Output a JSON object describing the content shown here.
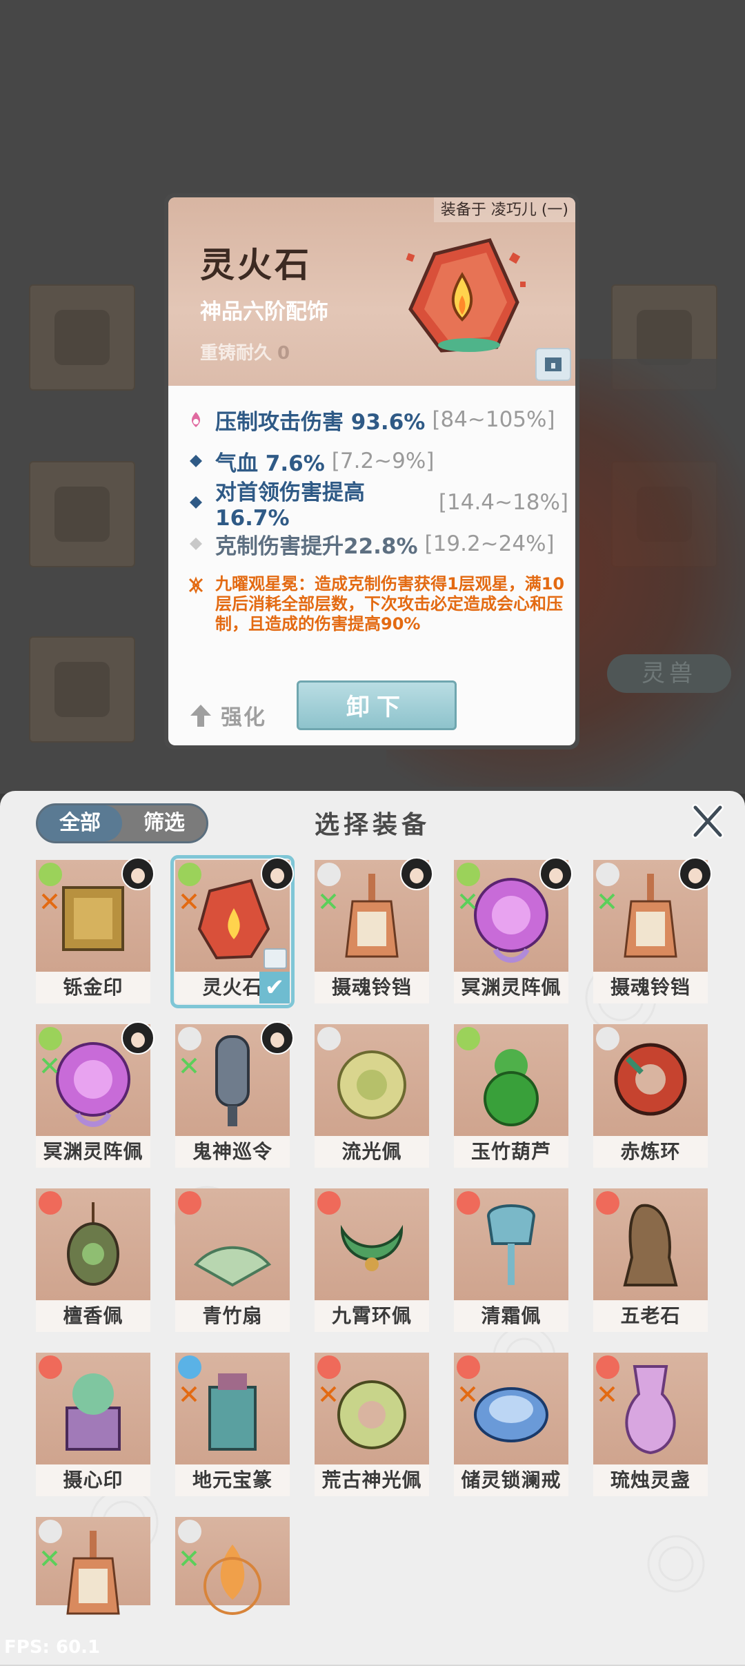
{
  "background": {
    "pet_button_label": "灵兽"
  },
  "detail": {
    "equipped_by": "装备于 凌巧儿 (一)",
    "name": "灵火石",
    "grade": "神品六阶配饰",
    "reforge_label": "重铸耐久",
    "reforge_value": "0",
    "stats": [
      {
        "name": "压制攻击伤害 93.6%",
        "range": "[84~105%]",
        "icon": "flame-icon"
      },
      {
        "name": "气血 7.6%",
        "range": "[7.2~9%]",
        "icon": "diamond-icon"
      },
      {
        "name": "对首领伤害提高 16.7%",
        "range": "[14.4~18%]",
        "icon": "diamond-icon"
      },
      {
        "name": "克制伤害提升22.8%",
        "range": "[19.2~24%]",
        "icon": "diamond-grey-icon"
      }
    ],
    "effect_text": "九曜观星冕：造成克制伤害获得1层观星，满10层后消耗全部层数，下次攻击必定造成会心和压制，且造成的伤害提高90%",
    "strengthen_label": "强化",
    "unequip_label": "卸下"
  },
  "panel": {
    "tabs": [
      "全部",
      "筛选"
    ],
    "title": "选择装备",
    "items": [
      {
        "name": "铄金印",
        "art": "seal"
      },
      {
        "name": "灵火石",
        "art": "stone",
        "selected": true
      },
      {
        "name": "摄魂铃铛",
        "art": "bell"
      },
      {
        "name": "冥渊灵阵佩",
        "art": "orb"
      },
      {
        "name": "摄魂铃铛",
        "art": "bell"
      },
      {
        "name": "冥渊灵阵佩",
        "art": "orb"
      },
      {
        "name": "鬼神巡令",
        "art": "token"
      },
      {
        "name": "流光佩",
        "art": "disc"
      },
      {
        "name": "玉竹葫芦",
        "art": "gourd"
      },
      {
        "name": "赤炼环",
        "art": "ring"
      },
      {
        "name": "檀香佩",
        "art": "pendant"
      },
      {
        "name": "青竹扇",
        "art": "fan"
      },
      {
        "name": "九霄环佩",
        "art": "crescent"
      },
      {
        "name": "清霜佩",
        "art": "frost"
      },
      {
        "name": "五老石",
        "art": "rock"
      },
      {
        "name": "摄心印",
        "art": "box"
      },
      {
        "name": "地元宝篆",
        "art": "tower"
      },
      {
        "name": "荒古神光佩",
        "art": "disc2"
      },
      {
        "name": "储灵锁澜戒",
        "art": "bangle"
      },
      {
        "name": "琉烛灵盏",
        "art": "vase"
      },
      {
        "name": "",
        "art": "bell"
      },
      {
        "name": "",
        "art": "flame"
      }
    ]
  },
  "fps_text": "FPS: 60.1"
}
